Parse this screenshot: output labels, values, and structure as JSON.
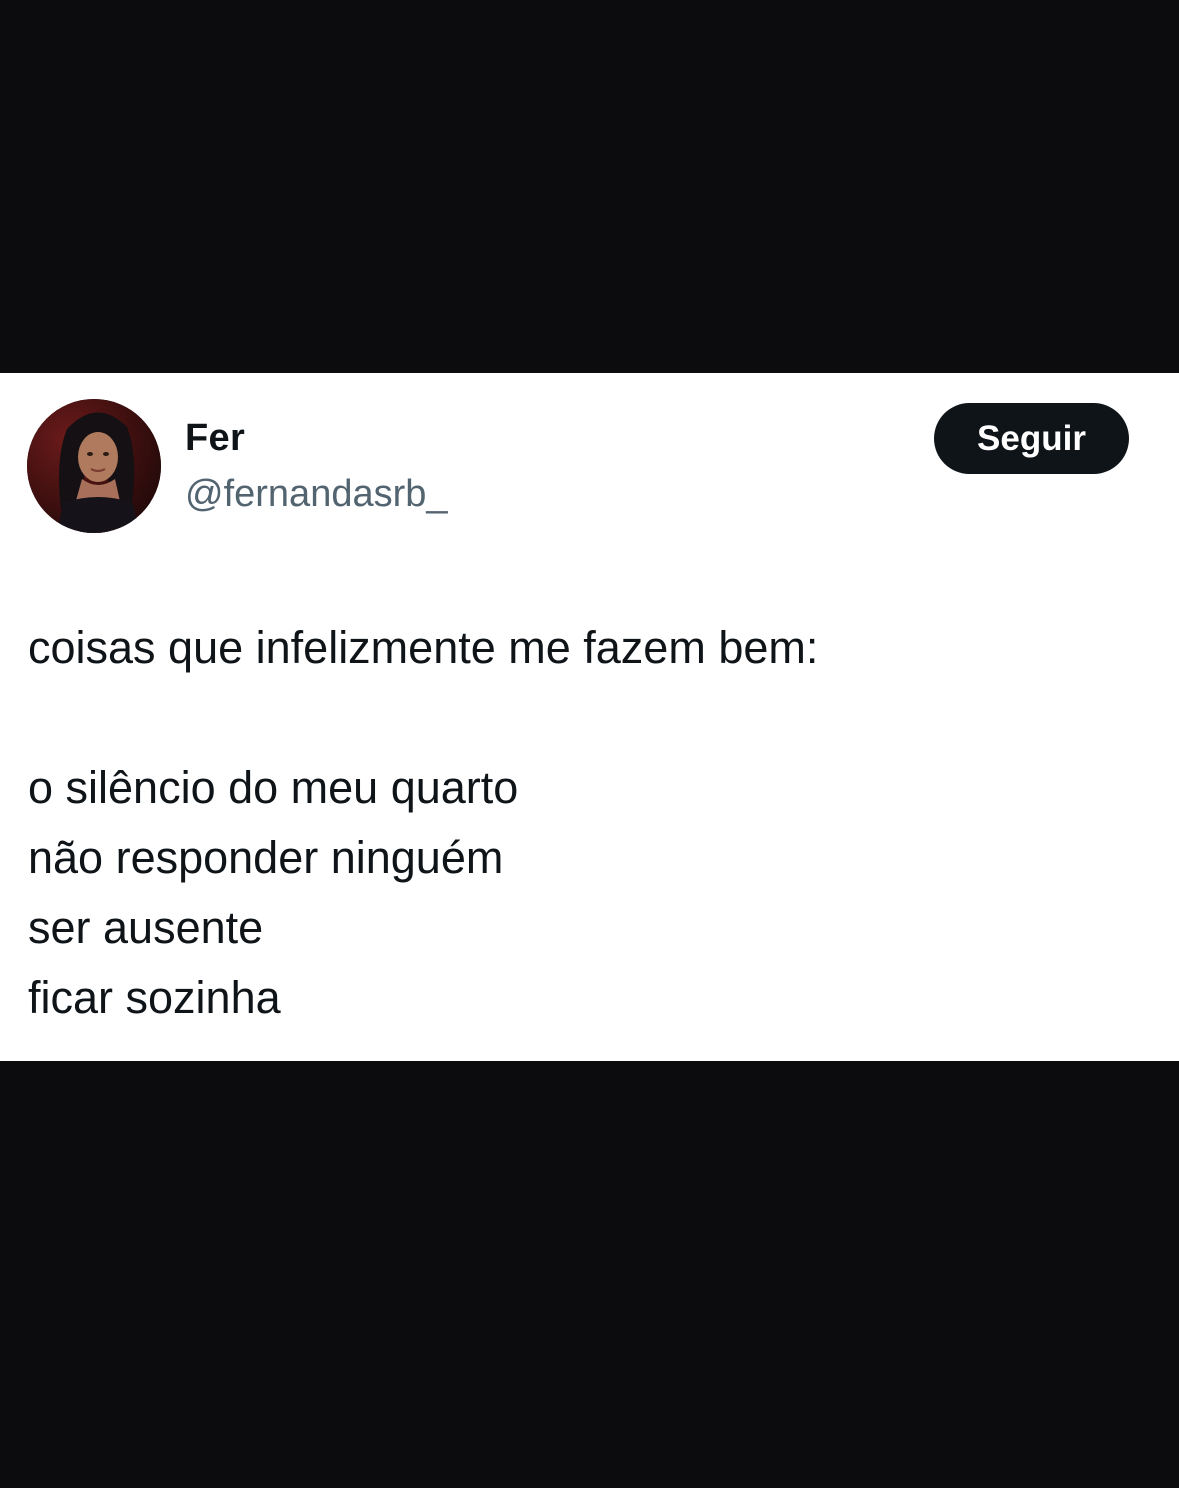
{
  "tweet": {
    "author": {
      "display_name": "Fer",
      "handle": "@fernandasrb_"
    },
    "follow_label": "Seguir",
    "lines": [
      "coisas que infelizmente me fazem bem:",
      "",
      "o silêncio do meu quarto",
      "não responder ninguém",
      "ser ausente",
      "ficar sozinha"
    ]
  }
}
